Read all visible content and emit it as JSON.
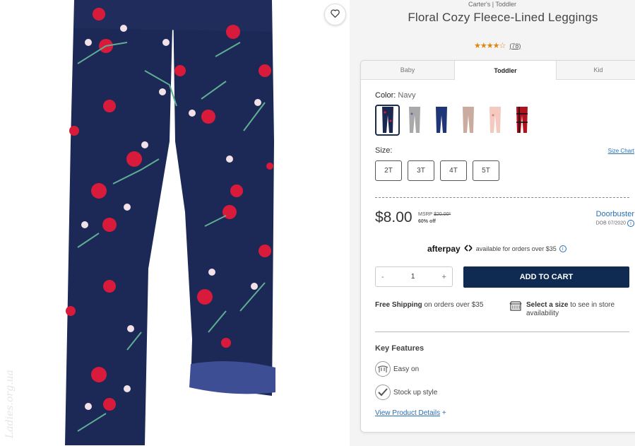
{
  "product": {
    "breadcrumb": "Carter's | Toddler",
    "title": "Floral Cozy Fleece-Lined Leggings",
    "rating_stars": "★★★★☆",
    "rating_count": "(78)"
  },
  "tabs": [
    {
      "label": "Baby",
      "active": false
    },
    {
      "label": "Toddler",
      "active": true
    },
    {
      "label": "Kid",
      "active": false
    }
  ],
  "color": {
    "label": "Color:",
    "selected": "Navy",
    "swatches": [
      {
        "name": "navy-floral",
        "color": "#1b2750",
        "selected": true
      },
      {
        "name": "grey-floral",
        "color": "#a9a9ab",
        "selected": false
      },
      {
        "name": "navy",
        "color": "#1e3578",
        "selected": false
      },
      {
        "name": "taupe",
        "color": "#c9ac9f",
        "selected": false
      },
      {
        "name": "pink-floral",
        "color": "#f3c9c0",
        "selected": false
      },
      {
        "name": "red-plaid",
        "color": "#b01320",
        "selected": false
      }
    ]
  },
  "size": {
    "label": "Size:",
    "chart_link": "Size Chart",
    "options": [
      "2T",
      "3T",
      "4T",
      "5T"
    ]
  },
  "pricing": {
    "price": "$8.00",
    "msrp_label": "MSRP",
    "msrp_value": "$20.00*",
    "discount": "60% off",
    "deal_label": "Doorbuster",
    "deal_date": "DOB 07/2020"
  },
  "afterpay": {
    "logo": "afterpay",
    "text": "available for orders over $35"
  },
  "cart": {
    "minus": "-",
    "quantity": "1",
    "plus": "+",
    "add_label": "ADD TO CART"
  },
  "shipping": {
    "bold": "Free Shipping",
    "rest": "on orders over $35"
  },
  "store": {
    "bold": "Select a size",
    "rest": "to see in store availability"
  },
  "features": {
    "title": "Key Features",
    "items": [
      "Easy on",
      "Stock up style"
    ],
    "details_link": "View Product Details",
    "details_plus": "+"
  },
  "watermark": "Ladies.org.ua",
  "colors": {
    "navy_button": "#0f2b52",
    "link_blue": "#2a6fb5",
    "star_orange": "#e1860c"
  }
}
